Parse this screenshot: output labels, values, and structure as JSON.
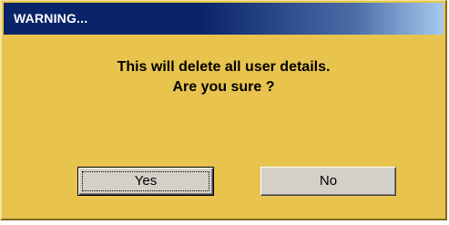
{
  "dialog": {
    "title": "WARNING...",
    "message_line1": "This will delete all user details.",
    "message_line2": "Are you sure ?",
    "yes_label": "Yes",
    "no_label": "No"
  },
  "colors": {
    "dialog_background": "#e8c44e",
    "titlebar_start": "#0a246a",
    "titlebar_end": "#a6caf0",
    "button_face": "#d4d0c8"
  }
}
